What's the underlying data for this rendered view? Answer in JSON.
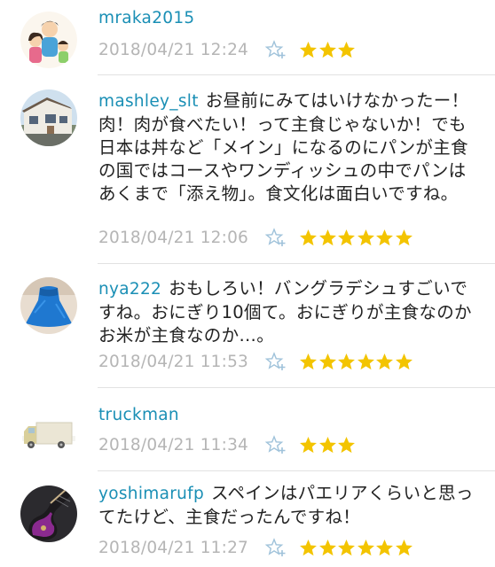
{
  "colors": {
    "username": "#1a8fb5",
    "timestamp": "#b5b5b5",
    "star": "#f3c400",
    "fav_icon": "#9fc2da",
    "divider": "#e2e2e2"
  },
  "comments": [
    {
      "username": "mraka2015",
      "text": "",
      "timestamp": "2018/04/21 12:24",
      "stars": 3,
      "avatar": "family-illustration-avatar"
    },
    {
      "username": "mashley_slt",
      "text": "お昼前にみてはいけなかったー！肉！肉が食べたい！って主食じゃないか！でも日本は丼など「メイン」になるのにパンが主食の国ではコースやワンディッシュの中でパンはあくまで「添え物」。食文化は面白いですね。",
      "timestamp": "2018/04/21 12:06",
      "stars": 6,
      "avatar": "house-photo-avatar"
    },
    {
      "username": "nya222",
      "text": "おもしろい！バングラデシュすごいですね。おにぎり10個て。おにぎりが主食なのかお米が主食なのか…。",
      "timestamp": "2018/04/21 11:53",
      "stars": 6,
      "avatar": "blue-dress-avatar"
    },
    {
      "username": "truckman",
      "text": "",
      "timestamp": "2018/04/21 11:34",
      "stars": 3,
      "avatar": "truck-avatar"
    },
    {
      "username": "yoshimarufp",
      "text": "スペインはパエリアくらいと思ってたけど、主食だったんですね！",
      "timestamp": "2018/04/21 11:27",
      "stars": 6,
      "avatar": "guitar-photo-avatar"
    }
  ]
}
